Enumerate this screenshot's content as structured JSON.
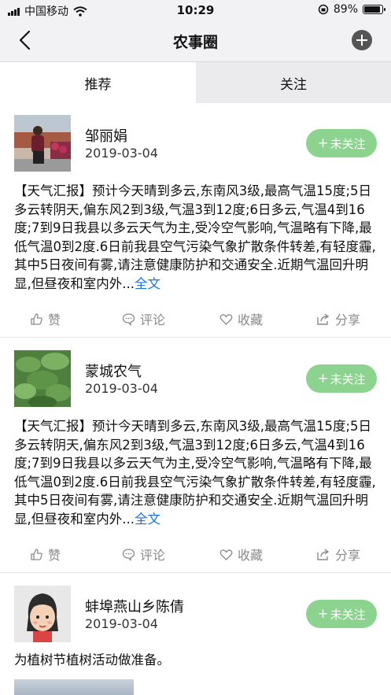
{
  "status_bar": {
    "carrier": "中国移动",
    "time": "10:29",
    "battery": "89%",
    "battery_level": 0.89
  },
  "nav": {
    "title": "农事圈"
  },
  "tabs": [
    {
      "label": "推荐"
    },
    {
      "label": "关注"
    }
  ],
  "posts": [
    {
      "name": "邹丽娟",
      "date": "2019-03-04",
      "follow_label": "未关注",
      "content": "【天气汇报】预计今天晴到多云,东南风3级,最高气温15度;5日多云转阴天,偏东风2到3级,气温3到12度;6日多云,气温4到16度;7到9日我县以多云天气为主,受冷空气影响,气温略有下降,最低气温0到2度.6日前我县空气污染气象扩散条件转差,有轻度霾,其中5日夜间有雾,请注意健康防护和交通安全.近期气温回升明显,但昼夜和室内外...",
      "more": "全文",
      "actions": {
        "like": "赞",
        "comment": "评论",
        "collect": "收藏",
        "share": "分享"
      }
    },
    {
      "name": "蒙城农气",
      "date": "2019-03-04",
      "follow_label": "未关注",
      "content": "【天气汇报】预计今天晴到多云,东南风3级,最高气温15度;5日多云转阴天,偏东风2到3级,气温3到12度;6日多云,气温4到16度;7到9日我县以多云天气为主,受冷空气影响,气温略有下降,最低气温0到2度.6日前我县空气污染气象扩散条件转差,有轻度霾,其中5日夜间有雾,请注意健康防护和交通安全.近期气温回升明显,但昼夜和室内外...",
      "more": "全文",
      "actions": {
        "like": "赞",
        "comment": "评论",
        "collect": "收藏",
        "share": "分享"
      }
    },
    {
      "name": "蚌埠燕山乡陈倩",
      "date": "2019-03-04",
      "follow_label": "未关注",
      "content": "为植树节植树活动做准备。"
    }
  ]
}
